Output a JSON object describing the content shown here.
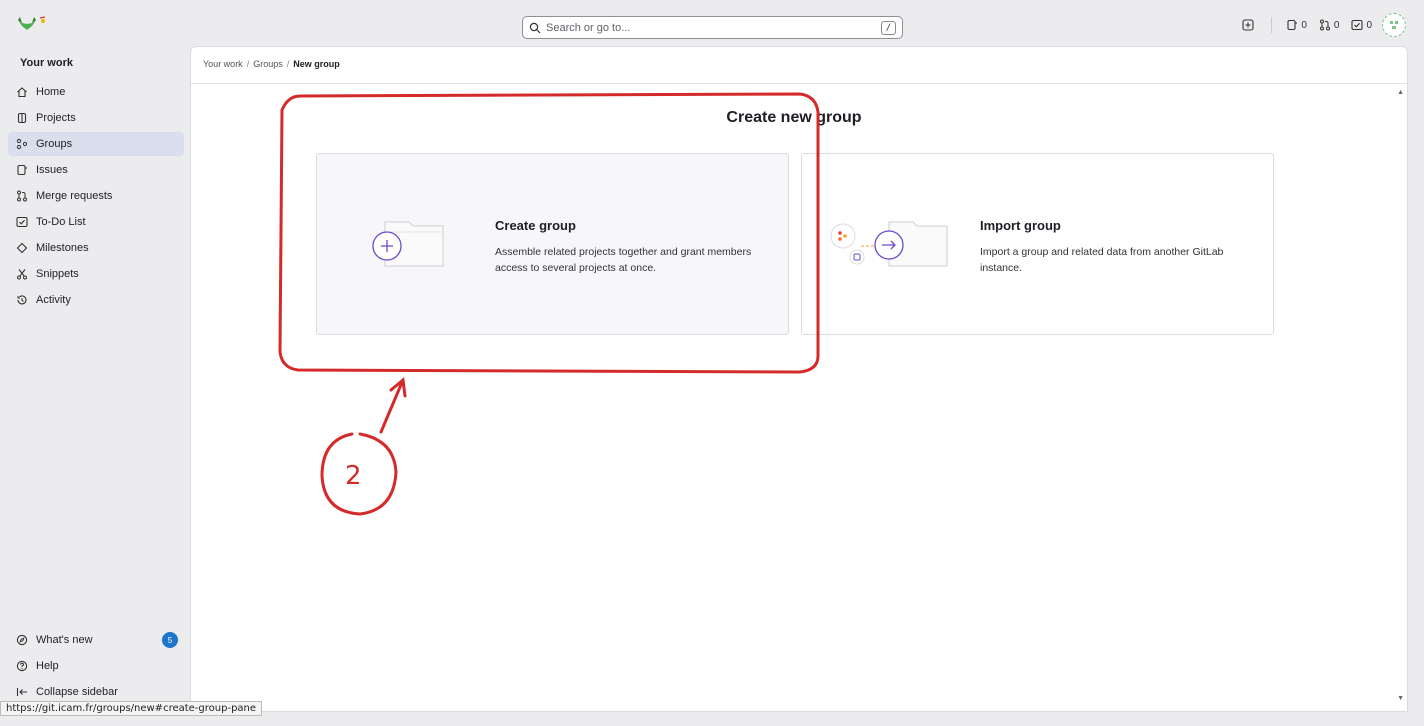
{
  "topbar": {
    "search_placeholder": "Search or go to...",
    "search_shortcut": "/",
    "issues_count": "0",
    "mr_count": "0",
    "todo_count": "0"
  },
  "sidebar": {
    "title": "Your work",
    "items": [
      {
        "label": "Home",
        "icon": "home-icon"
      },
      {
        "label": "Projects",
        "icon": "project-icon"
      },
      {
        "label": "Groups",
        "icon": "group-icon",
        "active": true
      },
      {
        "label": "Issues",
        "icon": "issues-icon"
      },
      {
        "label": "Merge requests",
        "icon": "merge-request-icon"
      },
      {
        "label": "To-Do List",
        "icon": "todo-icon"
      },
      {
        "label": "Milestones",
        "icon": "milestone-icon"
      },
      {
        "label": "Snippets",
        "icon": "snippet-icon"
      },
      {
        "label": "Activity",
        "icon": "history-icon"
      }
    ],
    "bottom": {
      "whats_new": "What's new",
      "whats_new_badge": "5",
      "help": "Help",
      "collapse": "Collapse sidebar"
    }
  },
  "breadcrumb": [
    "Your work",
    "Groups",
    "New group"
  ],
  "page": {
    "title": "Create new group",
    "create_card": {
      "title": "Create group",
      "description": "Assemble related projects together and grant members access to several projects at once."
    },
    "import_card": {
      "title": "Import group",
      "description": "Import a group and related data from another GitLab instance."
    }
  },
  "annotation": {
    "label": "2",
    "color": "#d42a2a"
  },
  "status_url": "https://git.icam.fr/groups/new#create-group-pane"
}
